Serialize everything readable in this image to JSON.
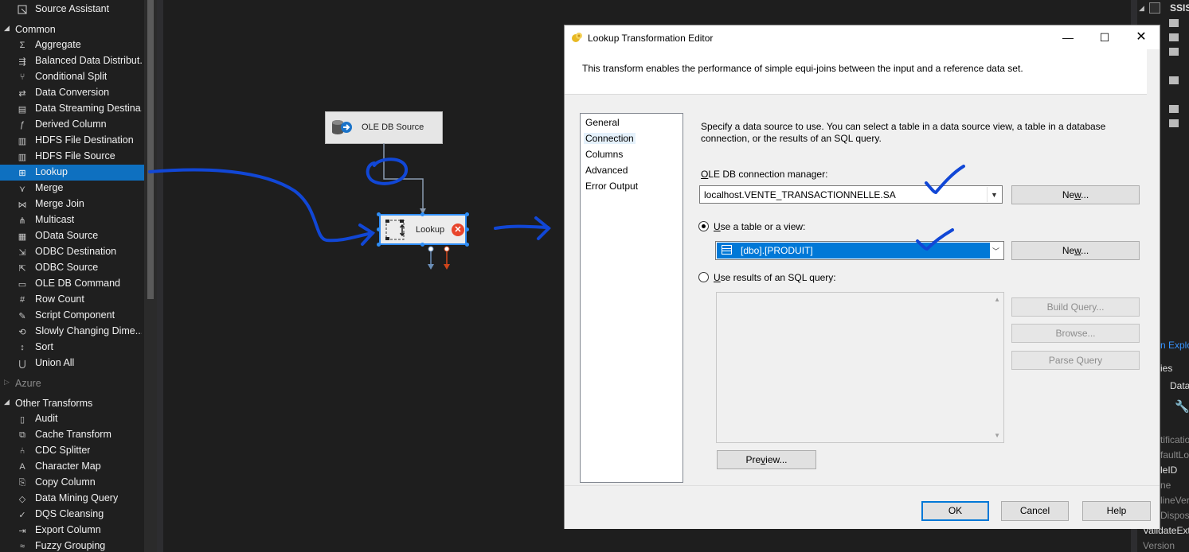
{
  "toolbox": {
    "top_item": {
      "label": "Source Assistant",
      "icon": "source-assistant-icon"
    },
    "common": {
      "label": "Common",
      "items": [
        {
          "label": "Aggregate",
          "icon": "aggregate-icon"
        },
        {
          "label": "Balanced Data Distribut...",
          "icon": "balanced-data-icon"
        },
        {
          "label": "Conditional Split",
          "icon": "conditional-split-icon"
        },
        {
          "label": "Data Conversion",
          "icon": "data-conversion-icon"
        },
        {
          "label": "Data Streaming Destina...",
          "icon": "data-streaming-icon"
        },
        {
          "label": "Derived Column",
          "icon": "derived-column-icon"
        },
        {
          "label": "HDFS File Destination",
          "icon": "hdfs-icon"
        },
        {
          "label": "HDFS File Source",
          "icon": "hdfs-icon"
        },
        {
          "label": "Lookup",
          "icon": "lookup-icon",
          "selected": true
        },
        {
          "label": "Merge",
          "icon": "merge-icon"
        },
        {
          "label": "Merge Join",
          "icon": "merge-join-icon"
        },
        {
          "label": "Multicast",
          "icon": "multicast-icon"
        },
        {
          "label": "OData Source",
          "icon": "odata-icon"
        },
        {
          "label": "ODBC Destination",
          "icon": "odbc-destination-icon"
        },
        {
          "label": "ODBC Source",
          "icon": "odbc-source-icon"
        },
        {
          "label": "OLE DB Command",
          "icon": "ole-db-command-icon"
        },
        {
          "label": "Row Count",
          "icon": "row-count-icon"
        },
        {
          "label": "Script Component",
          "icon": "script-component-icon"
        },
        {
          "label": "Slowly Changing Dime...",
          "icon": "slowly-changing-icon"
        },
        {
          "label": "Sort",
          "icon": "sort-icon"
        },
        {
          "label": "Union All",
          "icon": "union-all-icon"
        }
      ]
    },
    "azure": {
      "label": "Azure"
    },
    "other": {
      "label": "Other Transforms",
      "items": [
        {
          "label": "Audit",
          "icon": "audit-icon"
        },
        {
          "label": "Cache Transform",
          "icon": "cache-transform-icon"
        },
        {
          "label": "CDC Splitter",
          "icon": "cdc-splitter-icon"
        },
        {
          "label": "Character Map",
          "icon": "character-map-icon"
        },
        {
          "label": "Copy Column",
          "icon": "copy-column-icon"
        },
        {
          "label": "Data Mining Query",
          "icon": "data-mining-icon"
        },
        {
          "label": "DQS Cleansing",
          "icon": "dqs-cleansing-icon"
        },
        {
          "label": "Export Column",
          "icon": "export-column-icon"
        },
        {
          "label": "Fuzzy Grouping",
          "icon": "fuzzy-grouping-icon"
        }
      ]
    }
  },
  "canvas": {
    "ole_db_source": "OLE DB Source",
    "lookup": "Lookup"
  },
  "right_panel": {
    "title": "SSIS",
    "explorer": "n Explo",
    "rows": [
      "ies",
      "Data",
      "tificatio",
      "faultLo",
      "leID",
      "ne",
      "lineVer",
      "Dispos",
      "ValidateExt",
      "Version"
    ]
  },
  "dialog": {
    "title": "Lookup Transformation Editor",
    "description": "This transform enables the performance of simple equi-joins between the input and a reference data set.",
    "nav": [
      "General",
      "Connection",
      "Columns",
      "Advanced",
      "Error Output"
    ],
    "nav_selected": "Connection",
    "instructions": "Specify a data source to use. You can select a table in a data source view, a table in a database connection, or the results of an SQL query.",
    "conn_manager_label_underline": "O",
    "conn_manager_label_rest": "LE DB connection manager:",
    "conn_manager_value": "localhost.VENTE_TRANSACTIONNELLE.SA",
    "new_conn_u": "w",
    "radio_table_u": "U",
    "radio_table_rest": "se a table or a view:",
    "table_value": "[dbo].[PRODUIT]",
    "radio_sql_u": "U",
    "radio_sql_rest": "se results of an SQL query:",
    "build_query": "Build Query...",
    "browse": "Browse...",
    "parse_query": "Parse Query",
    "preview_u": "v",
    "ok": "OK",
    "cancel": "Cancel",
    "help": "Help"
  },
  "colors": {
    "selection": "#0078d7",
    "annotation": "#1147d6",
    "error": "#e8452c"
  }
}
